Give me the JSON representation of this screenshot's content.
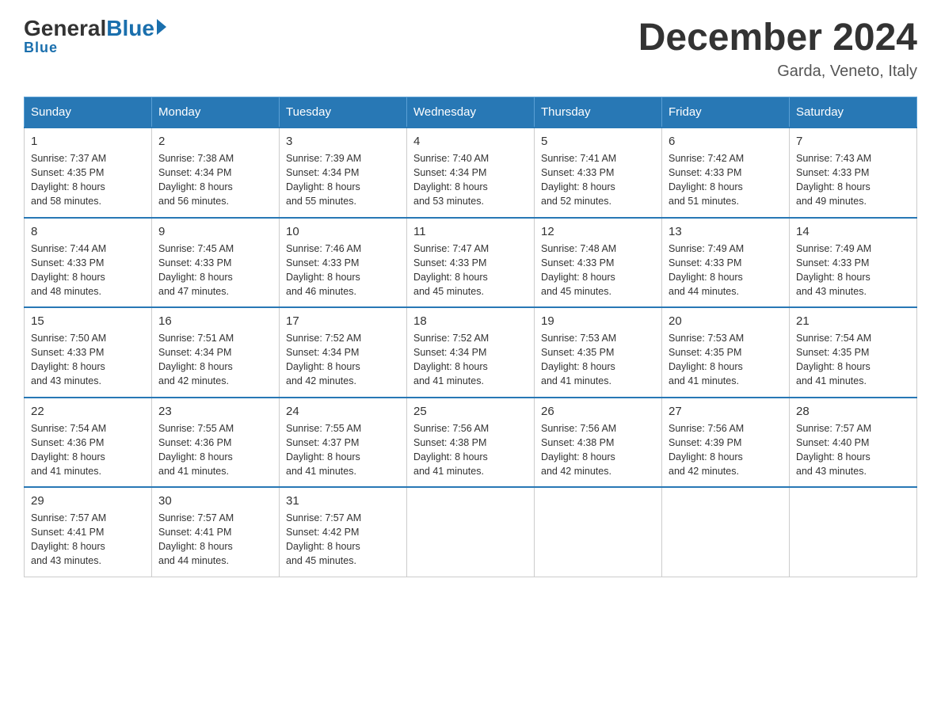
{
  "header": {
    "logo_general": "General",
    "logo_blue": "Blue",
    "month_title": "December 2024",
    "location": "Garda, Veneto, Italy"
  },
  "weekdays": [
    "Sunday",
    "Monday",
    "Tuesday",
    "Wednesday",
    "Thursday",
    "Friday",
    "Saturday"
  ],
  "weeks": [
    [
      {
        "day": "1",
        "sunrise": "7:37 AM",
        "sunset": "4:35 PM",
        "daylight": "8 hours and 58 minutes."
      },
      {
        "day": "2",
        "sunrise": "7:38 AM",
        "sunset": "4:34 PM",
        "daylight": "8 hours and 56 minutes."
      },
      {
        "day": "3",
        "sunrise": "7:39 AM",
        "sunset": "4:34 PM",
        "daylight": "8 hours and 55 minutes."
      },
      {
        "day": "4",
        "sunrise": "7:40 AM",
        "sunset": "4:34 PM",
        "daylight": "8 hours and 53 minutes."
      },
      {
        "day": "5",
        "sunrise": "7:41 AM",
        "sunset": "4:33 PM",
        "daylight": "8 hours and 52 minutes."
      },
      {
        "day": "6",
        "sunrise": "7:42 AM",
        "sunset": "4:33 PM",
        "daylight": "8 hours and 51 minutes."
      },
      {
        "day": "7",
        "sunrise": "7:43 AM",
        "sunset": "4:33 PM",
        "daylight": "8 hours and 49 minutes."
      }
    ],
    [
      {
        "day": "8",
        "sunrise": "7:44 AM",
        "sunset": "4:33 PM",
        "daylight": "8 hours and 48 minutes."
      },
      {
        "day": "9",
        "sunrise": "7:45 AM",
        "sunset": "4:33 PM",
        "daylight": "8 hours and 47 minutes."
      },
      {
        "day": "10",
        "sunrise": "7:46 AM",
        "sunset": "4:33 PM",
        "daylight": "8 hours and 46 minutes."
      },
      {
        "day": "11",
        "sunrise": "7:47 AM",
        "sunset": "4:33 PM",
        "daylight": "8 hours and 45 minutes."
      },
      {
        "day": "12",
        "sunrise": "7:48 AM",
        "sunset": "4:33 PM",
        "daylight": "8 hours and 45 minutes."
      },
      {
        "day": "13",
        "sunrise": "7:49 AM",
        "sunset": "4:33 PM",
        "daylight": "8 hours and 44 minutes."
      },
      {
        "day": "14",
        "sunrise": "7:49 AM",
        "sunset": "4:33 PM",
        "daylight": "8 hours and 43 minutes."
      }
    ],
    [
      {
        "day": "15",
        "sunrise": "7:50 AM",
        "sunset": "4:33 PM",
        "daylight": "8 hours and 43 minutes."
      },
      {
        "day": "16",
        "sunrise": "7:51 AM",
        "sunset": "4:34 PM",
        "daylight": "8 hours and 42 minutes."
      },
      {
        "day": "17",
        "sunrise": "7:52 AM",
        "sunset": "4:34 PM",
        "daylight": "8 hours and 42 minutes."
      },
      {
        "day": "18",
        "sunrise": "7:52 AM",
        "sunset": "4:34 PM",
        "daylight": "8 hours and 41 minutes."
      },
      {
        "day": "19",
        "sunrise": "7:53 AM",
        "sunset": "4:35 PM",
        "daylight": "8 hours and 41 minutes."
      },
      {
        "day": "20",
        "sunrise": "7:53 AM",
        "sunset": "4:35 PM",
        "daylight": "8 hours and 41 minutes."
      },
      {
        "day": "21",
        "sunrise": "7:54 AM",
        "sunset": "4:35 PM",
        "daylight": "8 hours and 41 minutes."
      }
    ],
    [
      {
        "day": "22",
        "sunrise": "7:54 AM",
        "sunset": "4:36 PM",
        "daylight": "8 hours and 41 minutes."
      },
      {
        "day": "23",
        "sunrise": "7:55 AM",
        "sunset": "4:36 PM",
        "daylight": "8 hours and 41 minutes."
      },
      {
        "day": "24",
        "sunrise": "7:55 AM",
        "sunset": "4:37 PM",
        "daylight": "8 hours and 41 minutes."
      },
      {
        "day": "25",
        "sunrise": "7:56 AM",
        "sunset": "4:38 PM",
        "daylight": "8 hours and 41 minutes."
      },
      {
        "day": "26",
        "sunrise": "7:56 AM",
        "sunset": "4:38 PM",
        "daylight": "8 hours and 42 minutes."
      },
      {
        "day": "27",
        "sunrise": "7:56 AM",
        "sunset": "4:39 PM",
        "daylight": "8 hours and 42 minutes."
      },
      {
        "day": "28",
        "sunrise": "7:57 AM",
        "sunset": "4:40 PM",
        "daylight": "8 hours and 43 minutes."
      }
    ],
    [
      {
        "day": "29",
        "sunrise": "7:57 AM",
        "sunset": "4:41 PM",
        "daylight": "8 hours and 43 minutes."
      },
      {
        "day": "30",
        "sunrise": "7:57 AM",
        "sunset": "4:41 PM",
        "daylight": "8 hours and 44 minutes."
      },
      {
        "day": "31",
        "sunrise": "7:57 AM",
        "sunset": "4:42 PM",
        "daylight": "8 hours and 45 minutes."
      },
      null,
      null,
      null,
      null
    ]
  ],
  "labels": {
    "sunrise": "Sunrise:",
    "sunset": "Sunset:",
    "daylight": "Daylight:"
  }
}
